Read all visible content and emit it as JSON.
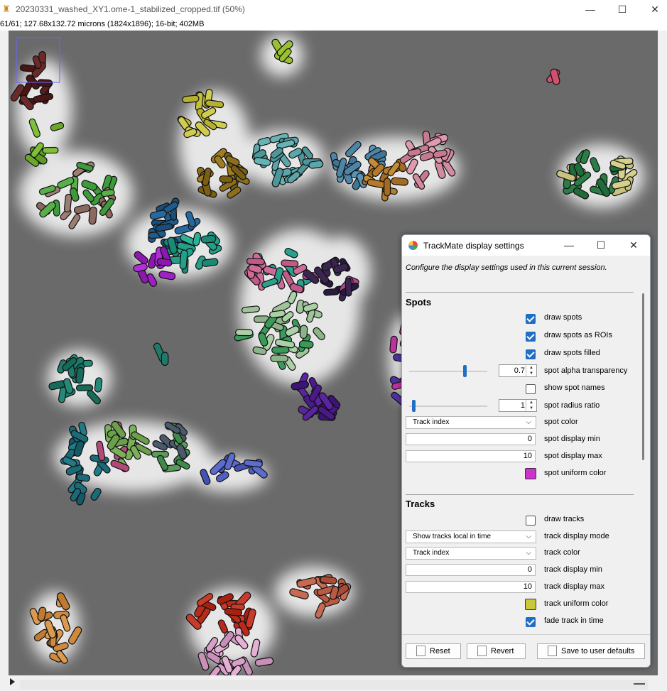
{
  "window": {
    "title": "20230331_washed_XY1.ome-1_stabilized_cropped.tif (50%)",
    "info": "61/61; 127.68x132.72 microns (1824x1896); 16-bit; 402MB",
    "minimize": "—",
    "maximize": "☐",
    "close": "✕"
  },
  "dialog": {
    "title": "TrackMate display settings",
    "description": "Configure the display settings used in this current session.",
    "minimize": "—",
    "maximize": "☐",
    "close": "✕",
    "spots": {
      "heading": "Spots",
      "draw_spots": {
        "label": "draw spots",
        "checked": true
      },
      "draw_spots_rois": {
        "label": "draw spots as ROIs",
        "checked": true
      },
      "draw_spots_filled": {
        "label": "draw spots filled",
        "checked": true
      },
      "alpha": {
        "label": "spot alpha transparency",
        "value": "0.7",
        "fraction": 0.7
      },
      "show_names": {
        "label": "show spot names",
        "checked": false
      },
      "radius": {
        "label": "spot radius ratio",
        "value": "1"
      },
      "color": {
        "label": "spot color",
        "selected": "Track index"
      },
      "display_min": {
        "label": "spot display min",
        "value": "0"
      },
      "display_max": {
        "label": "spot display max",
        "value": "10"
      },
      "uniform_color": {
        "label": "spot uniform color",
        "color": "#cc33cc"
      }
    },
    "tracks": {
      "heading": "Tracks",
      "draw_tracks": {
        "label": "draw tracks",
        "checked": false
      },
      "display_mode": {
        "label": "track display mode",
        "selected": "Show tracks local in time"
      },
      "color": {
        "label": "track color",
        "selected": "Track index"
      },
      "display_min": {
        "label": "track display min",
        "value": "0"
      },
      "display_max": {
        "label": "track display max",
        "value": "10"
      },
      "uniform_color": {
        "label": "track uniform color",
        "color": "#c8c83a"
      },
      "fade": {
        "label": "fade track in time",
        "checked": true
      }
    },
    "buttons": {
      "reset": "Reset",
      "revert": "Revert",
      "save": "Save to user defaults"
    }
  },
  "colors": {
    "accent": "#1f6fc5",
    "canvas_background": "#6c6c6c"
  }
}
